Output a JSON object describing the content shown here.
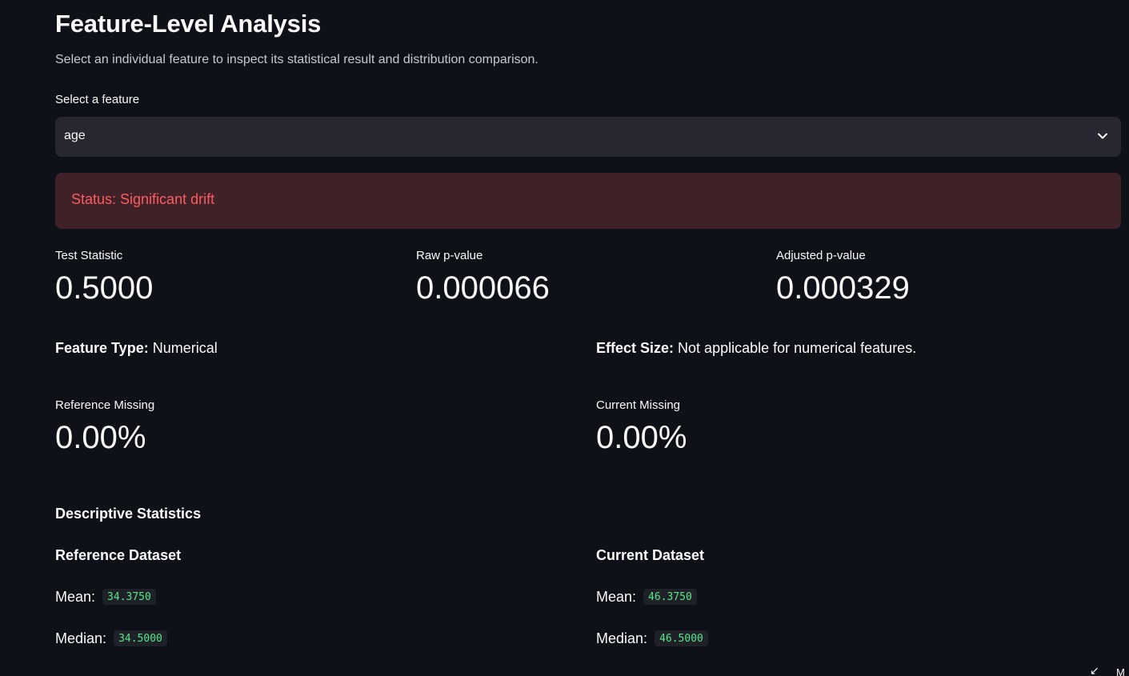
{
  "header": {
    "title": "Feature-Level Analysis",
    "subtitle": "Select an individual feature to inspect its statistical result and distribution comparison."
  },
  "feature_select": {
    "label": "Select a feature",
    "value": "age",
    "icon": "chevron-down-icon"
  },
  "status": {
    "text": "Status: Significant drift",
    "text_color": "#ff5a5f",
    "background": "#3e2228"
  },
  "metrics": {
    "test_statistic": {
      "label": "Test Statistic",
      "value": "0.5000"
    },
    "raw_p_value": {
      "label": "Raw p-value",
      "value": "0.000066"
    },
    "adjusted_p_value": {
      "label": "Adjusted p-value",
      "value": "0.000329"
    }
  },
  "feature_info": {
    "type_label": "Feature Type:",
    "type_value": "Numerical",
    "effect_label": "Effect Size:",
    "effect_value": "Not applicable for numerical features."
  },
  "missing": {
    "reference": {
      "label": "Reference Missing",
      "value": "0.00%"
    },
    "current": {
      "label": "Current Missing",
      "value": "0.00%"
    }
  },
  "descriptive": {
    "title": "Descriptive Statistics",
    "reference": {
      "title": "Reference Dataset",
      "mean_label": "Mean:",
      "mean_value": "34.3750",
      "median_label": "Median:",
      "median_value": "34.5000"
    },
    "current": {
      "title": "Current Dataset",
      "mean_label": "Mean:",
      "mean_value": "46.3750",
      "median_label": "Median:",
      "median_value": "46.5000"
    }
  },
  "corner": {
    "glyph": "↙",
    "text": "M"
  },
  "colors": {
    "background": "#0e1117",
    "select_background": "#262730",
    "code_text": "#5ce488"
  }
}
